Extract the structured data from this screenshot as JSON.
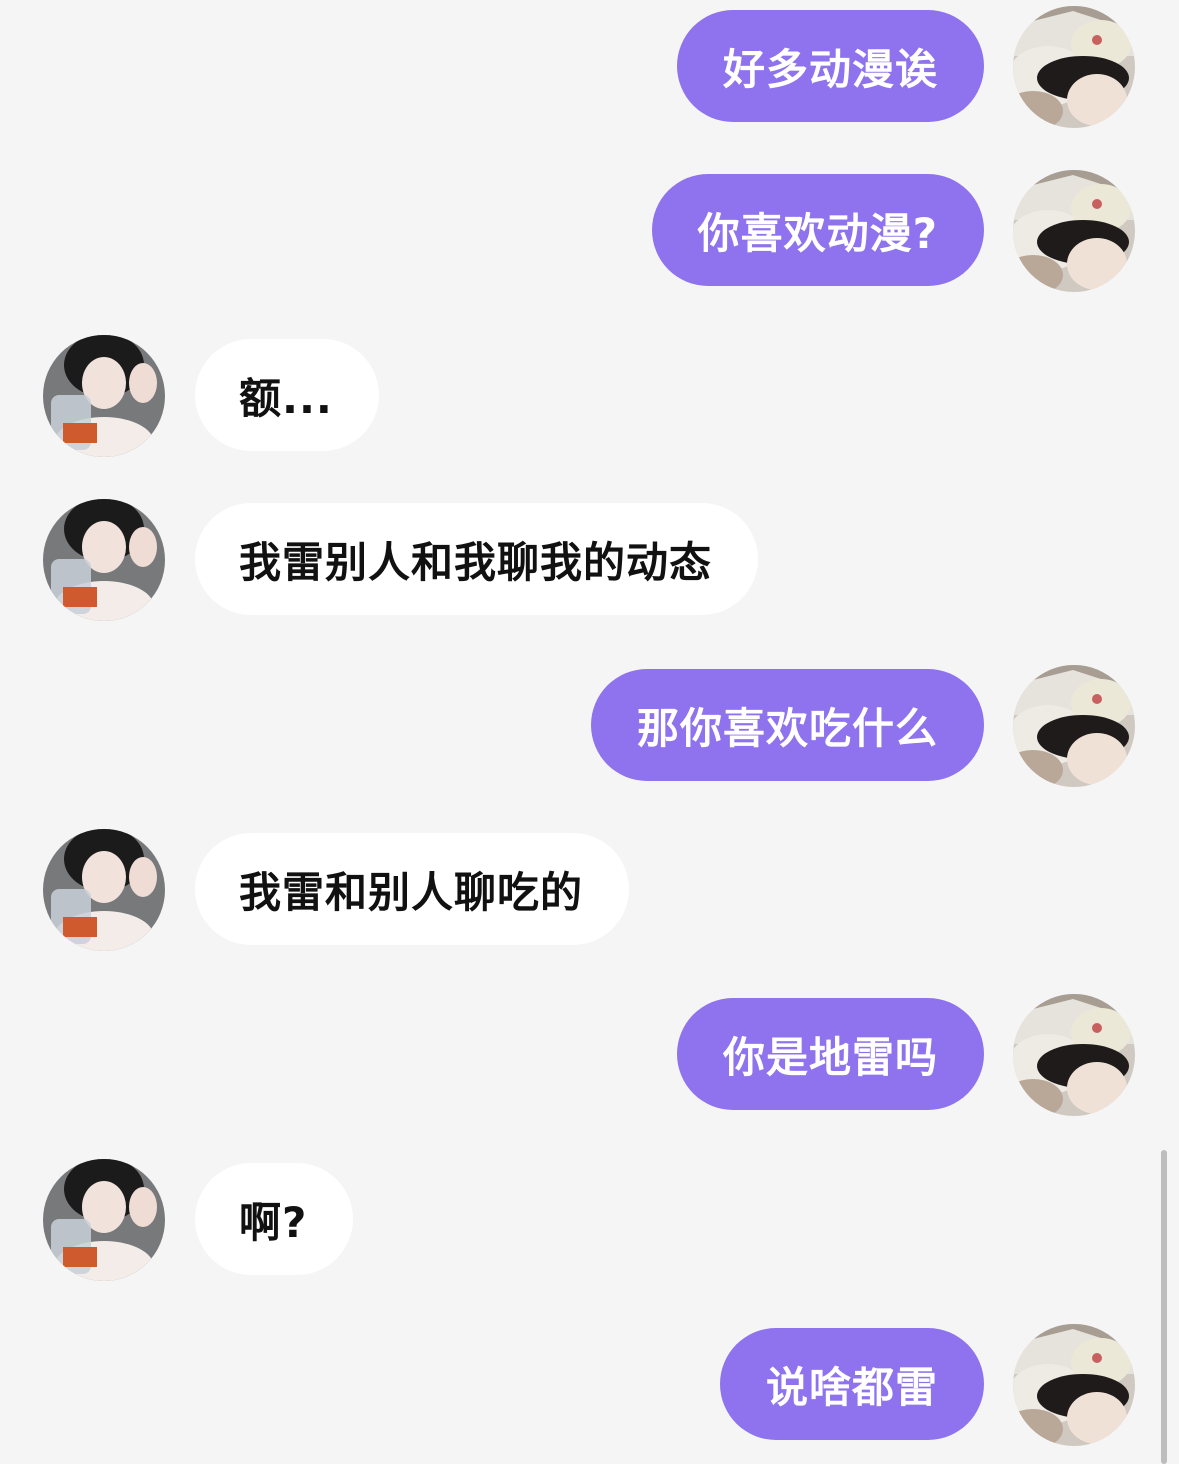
{
  "colors": {
    "background": "#f5f5f5",
    "outgoing_bubble": "#8f72ed",
    "incoming_bubble": "#ffffff",
    "outgoing_text": "#ffffff",
    "incoming_text": "#111111"
  },
  "avatars": {
    "self": "photo-avatar-person-lying-in-bed",
    "contact": "photo-avatar-girl-holding-bag"
  },
  "messages": [
    {
      "sender": "self",
      "text": "好多动漫诶"
    },
    {
      "sender": "self",
      "text": "你喜欢动漫?"
    },
    {
      "sender": "contact",
      "text": "额..."
    },
    {
      "sender": "contact",
      "text": "我雷别人和我聊我的动态"
    },
    {
      "sender": "self",
      "text": "那你喜欢吃什么"
    },
    {
      "sender": "contact",
      "text": "我雷和别人聊吃的"
    },
    {
      "sender": "self",
      "text": "你是地雷吗"
    },
    {
      "sender": "contact",
      "text": "啊?"
    },
    {
      "sender": "self",
      "text": "说啥都雷"
    }
  ]
}
